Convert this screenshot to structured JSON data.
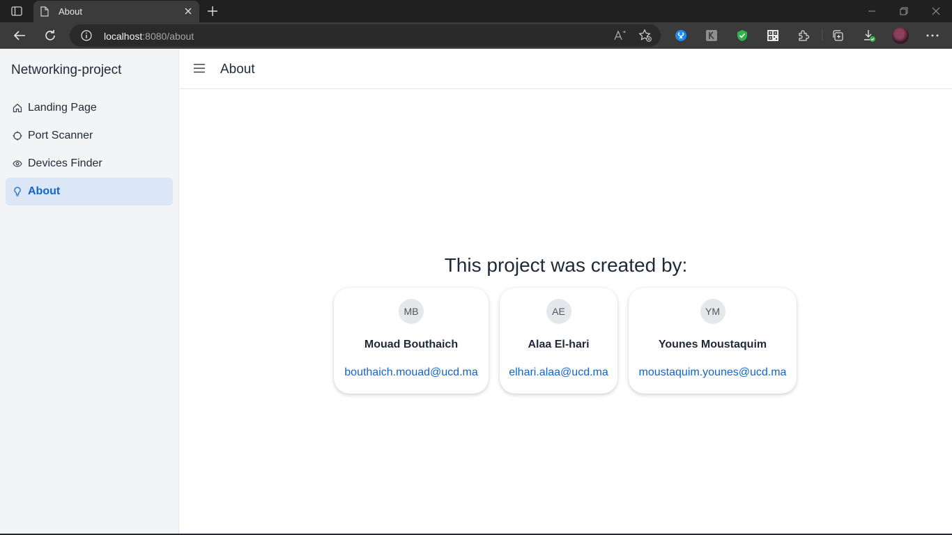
{
  "browser": {
    "tab_title": "About",
    "url_host": "localhost",
    "url_rest": ":8080/about",
    "extensions": [
      "shazam-icon",
      "reader-extension-icon",
      "adblock-shield-icon",
      "qr-code-icon",
      "extensions-puzzle-icon"
    ]
  },
  "app": {
    "brand": "Networking-project",
    "page_title": "About"
  },
  "sidebar": {
    "items": [
      {
        "label": "Landing Page",
        "icon": "home-icon",
        "active": false
      },
      {
        "label": "Port Scanner",
        "icon": "target-icon",
        "active": false
      },
      {
        "label": "Devices Finder",
        "icon": "eye-icon",
        "active": false
      },
      {
        "label": "About",
        "icon": "lightbulb-icon",
        "active": true
      }
    ]
  },
  "main": {
    "heading": "This project was created by:",
    "people": [
      {
        "initials": "MB",
        "name": "Mouad Bouthaich",
        "email": "bouthaich.mouad@ucd.ma"
      },
      {
        "initials": "AE",
        "name": "Alaa El-hari",
        "email": "elhari.alaa@ucd.ma"
      },
      {
        "initials": "YM",
        "name": "Younes Moustaquim",
        "email": "moustaquim.younes@ucd.ma"
      }
    ]
  },
  "colors": {
    "accent": "#1565c0",
    "active_nav_bg": "#dbe7f6",
    "sidebar_bg": "#f3f4f6"
  }
}
